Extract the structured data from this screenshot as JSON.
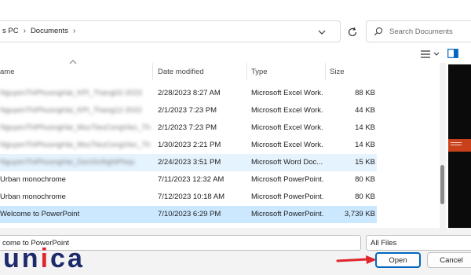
{
  "breadcrumb": [
    "s PC",
    "Documents"
  ],
  "search": {
    "placeholder": "Search Documents"
  },
  "columns": {
    "name": "ame",
    "date": "Date modified",
    "type": "Type",
    "size": "Size"
  },
  "files": [
    {
      "name": "NguyenThiPhuongHai_KPI_Thang02-2023",
      "date": "2/28/2023 8:27 AM",
      "type": "Microsoft Excel Work...",
      "size": "88 KB",
      "blurred": true,
      "state": ""
    },
    {
      "name": "NguyenThiPhuongHai_KPI_Thang12-2022",
      "date": "2/1/2023 7:23 PM",
      "type": "Microsoft Excel Work...",
      "size": "44 KB",
      "blurred": true,
      "state": ""
    },
    {
      "name": "NguyenThiPhuongHai_MucTieuCongViec_Thang01",
      "date": "2/1/2023 7:23 PM",
      "type": "Microsoft Excel Work...",
      "size": "14 KB",
      "blurred": true,
      "state": ""
    },
    {
      "name": "NguyenThiPhuongHai_MucTieuCongViec_Thang02",
      "date": "1/30/2023 2:21 PM",
      "type": "Microsoft Excel Work...",
      "size": "14 KB",
      "blurred": true,
      "state": ""
    },
    {
      "name": "NguyenThiPhuongHai_DonXinNghiPhep",
      "date": "2/24/2023 3:51 PM",
      "type": "Microsoft Word Doc...",
      "size": "15 KB",
      "blurred": true,
      "state": "hl"
    },
    {
      "name": "Urban monochrome",
      "date": "7/11/2023 12:32 AM",
      "type": "Microsoft PowerPoint...",
      "size": "80 KB",
      "blurred": false,
      "state": ""
    },
    {
      "name": "Urban monochrome",
      "date": "7/12/2023 10:18 AM",
      "type": "Microsoft PowerPoint...",
      "size": "80 KB",
      "blurred": false,
      "state": ""
    },
    {
      "name": "Welcome to PowerPoint",
      "date": "7/10/2023 6:29 PM",
      "type": "Microsoft PowerPoint...",
      "size": "3,739 KB",
      "blurred": false,
      "state": "sel"
    }
  ],
  "filename_value": "come to PowerPoint",
  "file_type": "All Files",
  "buttons": {
    "open": "Open",
    "cancel": "Cancel"
  },
  "logo": {
    "text": "unica",
    "colors": {
      "dark": "#1d2a6b",
      "red": "#e0262d"
    }
  },
  "colors": {
    "selected": "#cce8ff",
    "hover": "#e5f3ff",
    "accent": "#0067c0",
    "arrow": "#e0262d"
  }
}
